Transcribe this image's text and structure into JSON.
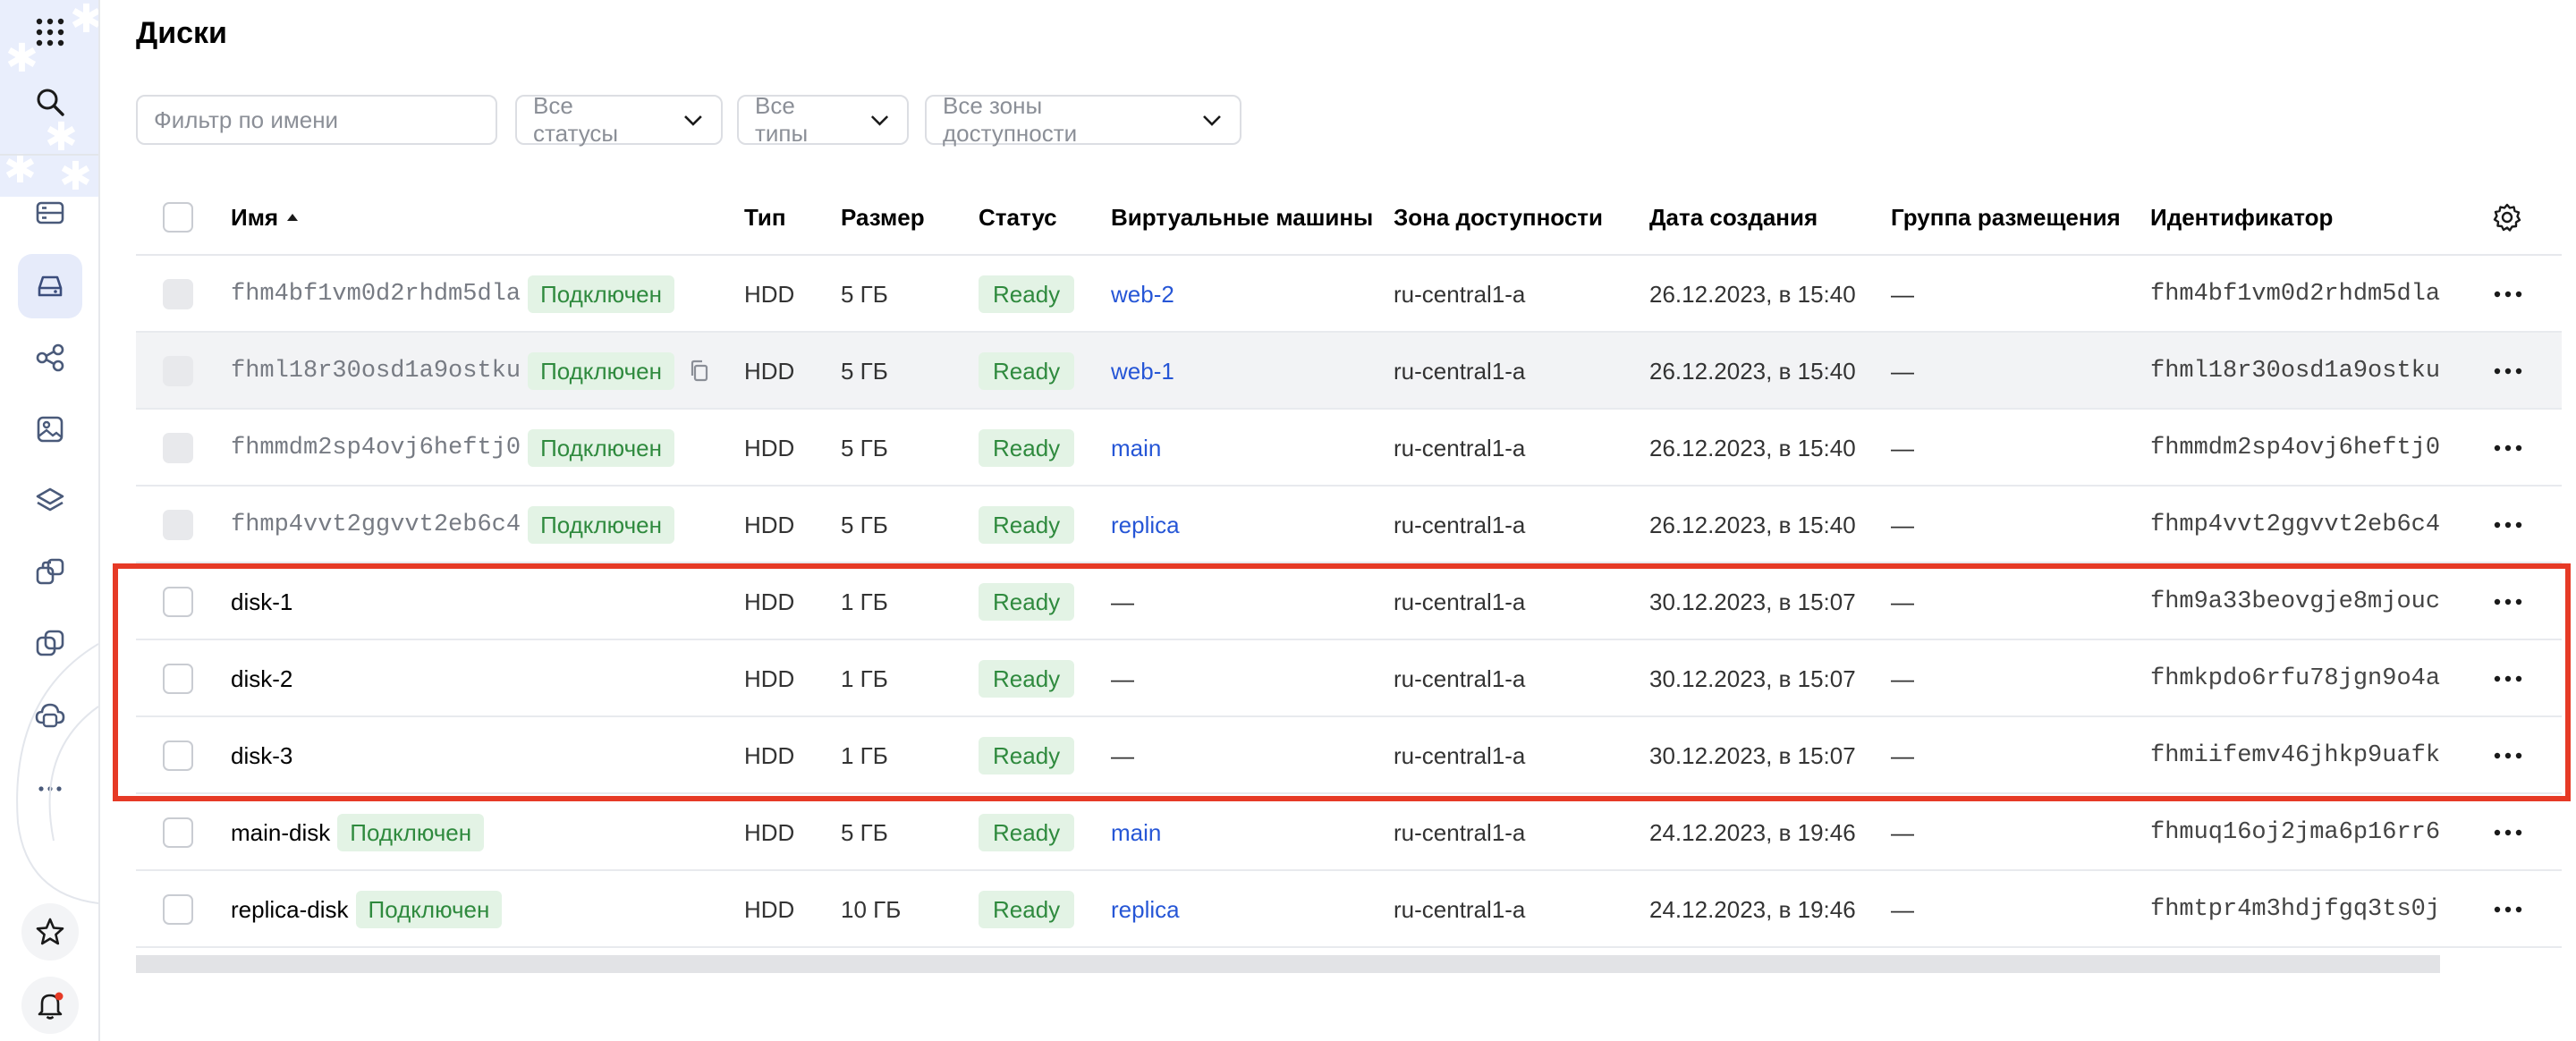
{
  "page": {
    "title": "Диски"
  },
  "filters": {
    "name_placeholder": "Фильтр по имени",
    "status": "Все статусы",
    "type": "Все типы",
    "zone": "Все зоны доступности"
  },
  "table": {
    "columns": {
      "name": "Имя",
      "type": "Тип",
      "size": "Размер",
      "status": "Статус",
      "vms": "Виртуальные машины",
      "zone": "Зона доступности",
      "created": "Дата создания",
      "placement": "Группа размещения",
      "id": "Идентификатор"
    },
    "rows": [
      {
        "name": "fhm4bf1vm0d2rhdm5dla",
        "badge": "Подключен",
        "type": "HDD",
        "size": "5 ГБ",
        "status": "Ready",
        "vm": "web-2",
        "zone": "ru-central1-a",
        "created": "26.12.2023, в 15:40",
        "placement": "—",
        "id": "fhm4bf1vm0d2rhdm5dla"
      },
      {
        "name": "fhml18r30osd1a9ostku",
        "badge": "Подключен",
        "type": "HDD",
        "size": "5 ГБ",
        "status": "Ready",
        "vm": "web-1",
        "zone": "ru-central1-a",
        "created": "26.12.2023, в 15:40",
        "placement": "—",
        "id": "fhml18r30osd1a9ostku"
      },
      {
        "name": "fhmmdm2sp4ovj6heftj0",
        "badge": "Подключен",
        "type": "HDD",
        "size": "5 ГБ",
        "status": "Ready",
        "vm": "main",
        "zone": "ru-central1-a",
        "created": "26.12.2023, в 15:40",
        "placement": "—",
        "id": "fhmmdm2sp4ovj6heftj0"
      },
      {
        "name": "fhmp4vvt2ggvvt2eb6c4",
        "badge": "Подключен",
        "type": "HDD",
        "size": "5 ГБ",
        "status": "Ready",
        "vm": "replica",
        "zone": "ru-central1-a",
        "created": "26.12.2023, в 15:40",
        "placement": "—",
        "id": "fhmp4vvt2ggvvt2eb6c4"
      },
      {
        "name": "disk-1",
        "type": "HDD",
        "size": "1 ГБ",
        "status": "Ready",
        "vm": "—",
        "zone": "ru-central1-a",
        "created": "30.12.2023, в 15:07",
        "placement": "—",
        "id": "fhm9a33beovgje8mjouc"
      },
      {
        "name": "disk-2",
        "type": "HDD",
        "size": "1 ГБ",
        "status": "Ready",
        "vm": "—",
        "zone": "ru-central1-a",
        "created": "30.12.2023, в 15:07",
        "placement": "—",
        "id": "fhmkpdo6rfu78jgn9o4a"
      },
      {
        "name": "disk-3",
        "type": "HDD",
        "size": "1 ГБ",
        "status": "Ready",
        "vm": "—",
        "zone": "ru-central1-a",
        "created": "30.12.2023, в 15:07",
        "placement": "—",
        "id": "fhmiifemv46jhkp9uafk"
      },
      {
        "name": "main-disk",
        "badge": "Подключен",
        "type": "HDD",
        "size": "5 ГБ",
        "status": "Ready",
        "vm": "main",
        "zone": "ru-central1-a",
        "created": "24.12.2023, в 19:46",
        "placement": "—",
        "id": "fhmuq16oj2jma6p16rr6"
      },
      {
        "name": "replica-disk",
        "badge": "Подключен",
        "type": "HDD",
        "size": "10 ГБ",
        "status": "Ready",
        "vm": "replica",
        "zone": "ru-central1-a",
        "created": "24.12.2023, в 19:46",
        "placement": "—",
        "id": "fhmtpr4m3hdjfgq3ts0j"
      }
    ]
  },
  "colors": {
    "highlight": "#e63a26",
    "link": "#2656d6",
    "status_green_bg": "#e3f3e5",
    "status_green_text": "#2f8a3e",
    "sidebar_active": "#e6ebfa"
  },
  "sidebar": {
    "icons": [
      "apps-grid-icon",
      "search-icon",
      "dashboard-icon",
      "disk-icon",
      "network-icon",
      "image-icon",
      "layers-icon",
      "snapshots-icon",
      "copy-icon",
      "cloud-disks-icon",
      "more-icon",
      "favorites-star-icon",
      "notifications-bell-icon"
    ]
  }
}
